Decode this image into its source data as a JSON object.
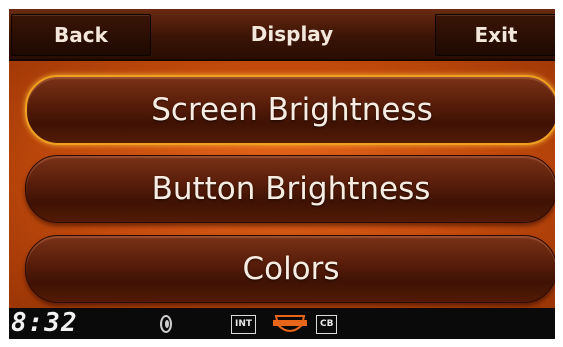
{
  "header": {
    "back_label": "Back",
    "title": "Display",
    "exit_label": "Exit"
  },
  "menu": {
    "items": [
      {
        "label": "Screen Brightness",
        "selected": true
      },
      {
        "label": "Button Brightness",
        "selected": false
      },
      {
        "label": "Colors",
        "selected": false
      }
    ]
  },
  "status": {
    "time": "8:32",
    "int_label": "INT",
    "cb_label": "CB",
    "icons": [
      "speaker-volume-icon",
      "bar-and-shield-logo-icon"
    ]
  },
  "colors": {
    "accent": "#e8651a",
    "selection_outline": "#f0a020",
    "button": "#5a1e0a"
  }
}
